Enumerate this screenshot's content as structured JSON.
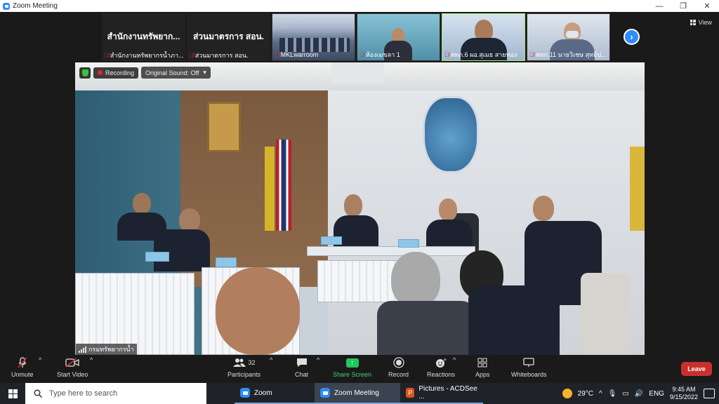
{
  "window": {
    "title": "Zoom Meeting",
    "controls": [
      "—",
      "❐",
      "✕"
    ]
  },
  "view_button": {
    "label": "View"
  },
  "thumbnails": [
    {
      "big_text": "สำนักงานทรัพยาก...",
      "caption": "สำนักงานทรัพยากรน้ำภา...",
      "muted": true
    },
    {
      "big_text": "ส่วนมาตรการ สอน.",
      "caption": "ส่วนมาตรการ สอน.",
      "muted": true
    },
    {
      "big_text": "",
      "caption": "MKLwarroom",
      "muted": true
    },
    {
      "big_text": "",
      "caption": "ห้องเมขลา 1",
      "muted": true
    },
    {
      "big_text": "",
      "caption": "สทภ.6 ผอ.สุเมธ สายทอง",
      "muted": true
    },
    {
      "big_text": "",
      "caption": "สทภ.11 นายวิเชษ สุทธิป...",
      "muted": true
    }
  ],
  "next_icon": "›",
  "recording": {
    "label": "Recording",
    "sound": "Original Sound: Off",
    "caret": "▾"
  },
  "speaker_name": "กรมทรัพยากรน้ำ",
  "toolbar": {
    "unmute": "Unmute",
    "start_video": "Start Video",
    "participants": "Participants",
    "participants_count": "32",
    "chat": "Chat",
    "share_screen": "Share Screen",
    "record": "Record",
    "reactions": "Reactions",
    "apps": "Apps",
    "whiteboards": "Whiteboards",
    "leave": "Leave",
    "caret": "^"
  },
  "taskbar": {
    "search_placeholder": "Type here to search",
    "apps": [
      {
        "label": "Zoom",
        "active": false
      },
      {
        "label": "Zoom Meeting",
        "active": true
      },
      {
        "label": "Pictures - ACDSee ...",
        "active": false
      }
    ],
    "temperature": "29°C",
    "language": "ENG",
    "time": "9:45 AM",
    "date": "9/15/2022"
  },
  "colors": {
    "zoom_blue": "#2d8cff",
    "leave_red": "#c9302c",
    "share_green": "#22c55e",
    "mic_off_red": "#e02828"
  }
}
